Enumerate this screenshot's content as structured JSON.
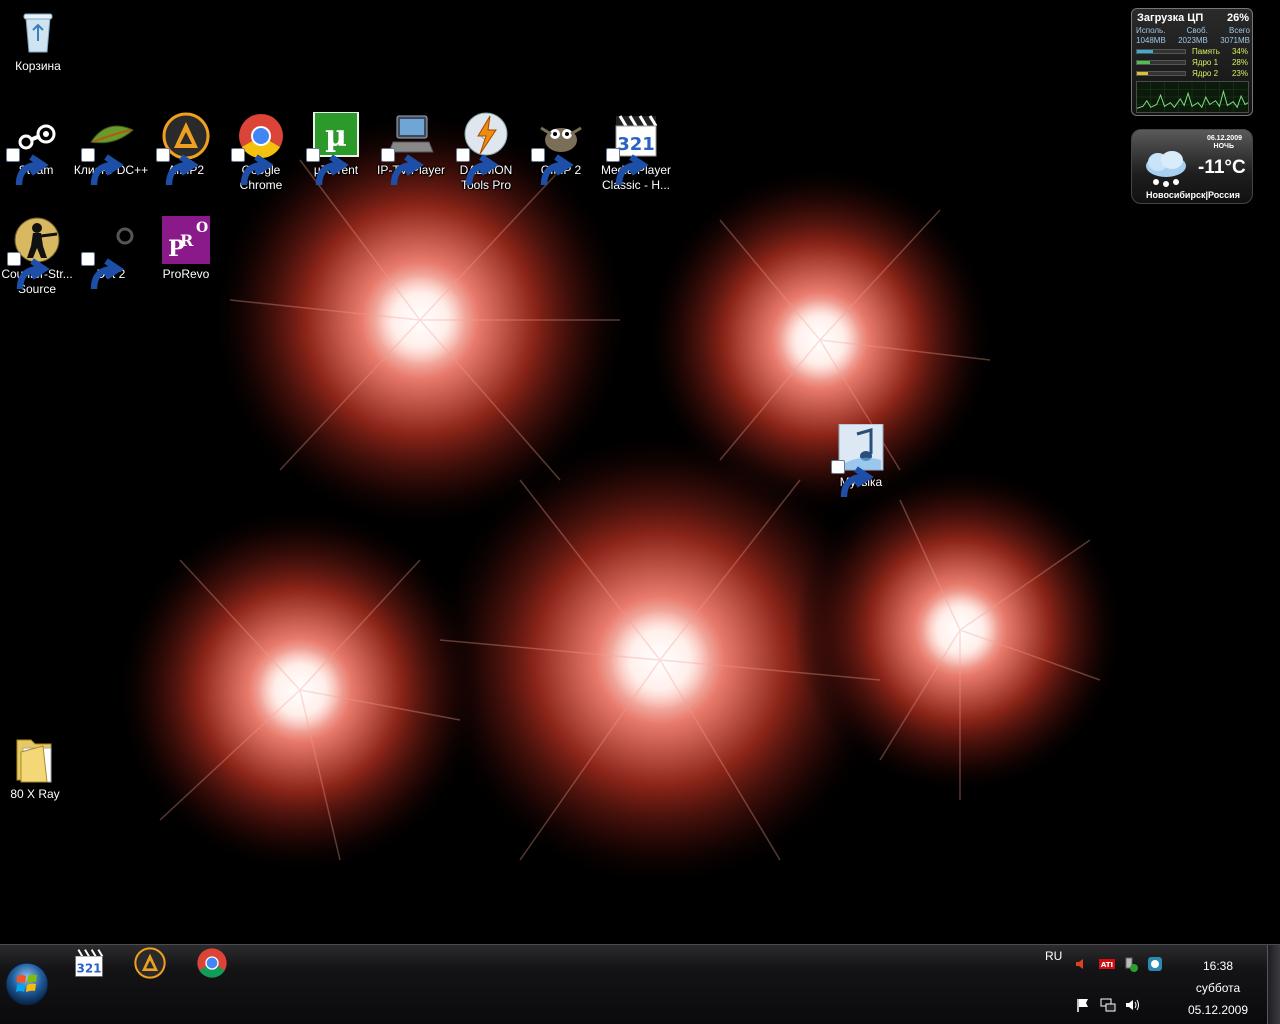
{
  "desktop": {
    "icons": [
      {
        "id": "recycle-bin",
        "label": "Корзина",
        "icon": "recycle-bin-icon",
        "shortcut": false
      },
      {
        "id": "steam",
        "label": "Steam",
        "icon": "steam-icon",
        "shortcut": true
      },
      {
        "id": "dcpp",
        "label": "Клиент DC++",
        "icon": "dcpp-icon",
        "shortcut": true
      },
      {
        "id": "aimp2",
        "label": "AIMP2",
        "icon": "aimp-icon",
        "shortcut": true
      },
      {
        "id": "chrome",
        "label": "Google Chrome",
        "icon": "chrome-icon",
        "shortcut": true
      },
      {
        "id": "utorrent",
        "label": "µTorrent",
        "icon": "utorrent-icon",
        "shortcut": true
      },
      {
        "id": "iptv",
        "label": "IP-TV Player",
        "icon": "iptv-player-icon",
        "shortcut": true
      },
      {
        "id": "daemon",
        "label": "DAEMON Tools Pro",
        "icon": "daemon-tools-icon",
        "shortcut": true
      },
      {
        "id": "gimp",
        "label": "GIMP 2",
        "icon": "gimp-icon",
        "shortcut": true
      },
      {
        "id": "mpc",
        "label": "Media Player Classic - H...",
        "icon": "media-player-classic-icon",
        "shortcut": true
      },
      {
        "id": "css",
        "label": "Counter-Str... Source",
        "icon": "counter-strike-icon",
        "shortcut": true
      },
      {
        "id": "dirt2",
        "label": "Dirt 2",
        "icon": "dirt2-icon",
        "shortcut": true
      },
      {
        "id": "prorevo",
        "label": "ProRevo",
        "icon": "prorevo-icon",
        "shortcut": false
      },
      {
        "id": "music",
        "label": "Музыка",
        "icon": "music-folder-icon",
        "shortcut": true
      },
      {
        "id": "xray",
        "label": "80 X Ray",
        "icon": "folder-icon",
        "shortcut": false
      }
    ]
  },
  "gadgets": {
    "cpu": {
      "title": "Загрузка ЦП",
      "total_percent": "26%",
      "cols": [
        "Исполь.",
        "Своб.",
        "Всего"
      ],
      "vals": [
        "1048MB",
        "2023MB",
        "3071MB"
      ],
      "meters": [
        {
          "name": "Память",
          "value": "34%",
          "fraction": 0.34,
          "color": "#3fa9d8"
        },
        {
          "name": "Ядро 1",
          "value": "28%",
          "fraction": 0.28,
          "color": "#4cc04c"
        },
        {
          "name": "Ядро 2",
          "value": "23%",
          "fraction": 0.23,
          "color": "#e0c030"
        }
      ]
    },
    "weather": {
      "date": "06.12.2009",
      "time_of_day": "НОЧЬ",
      "temperature": "-11°C",
      "city": "Новосибирск|Россия"
    }
  },
  "taskbar": {
    "start_label": "Start",
    "pinned": [
      {
        "label": "Media Player Classic",
        "icon": "media-player-classic-icon"
      },
      {
        "label": "AIMP2",
        "icon": "aimp-icon"
      },
      {
        "label": "Google Chrome",
        "icon": "chrome-icon"
      }
    ],
    "language": "RU",
    "clock": {
      "time": "16:38",
      "day": "суббота",
      "date": "05.12.2009"
    }
  }
}
